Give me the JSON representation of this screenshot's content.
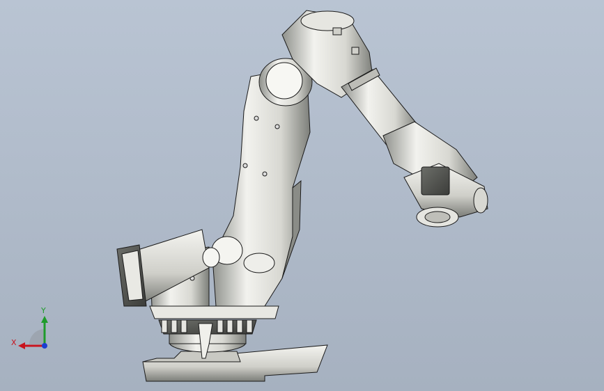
{
  "viewport": {
    "background_top": "#b9c4d3",
    "background_bottom": "#a6b1c0"
  },
  "model": {
    "type": "industrial-robot-arm",
    "render_style": "shaded-with-edges",
    "body_color": "#e2e2dd",
    "edge_color": "#1a1a1a"
  },
  "triad": {
    "x_label": "X",
    "y_label": "Y",
    "x_color": "#c8141e",
    "y_color": "#1e9b2a",
    "z_color": "#1c3fd1"
  }
}
